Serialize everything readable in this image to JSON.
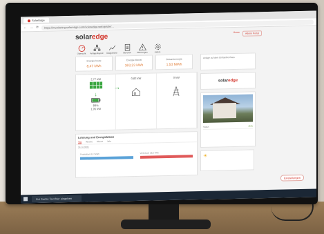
{
  "browser": {
    "tab_title": "SolarEdge",
    "url": "https://monitoring.solaredge.com/solaredge-web/p/site/..."
  },
  "header": {
    "logo_main": "solar",
    "logo_accent": "edge",
    "right_link": "Home",
    "right_button": "Admin Portal"
  },
  "nav": [
    {
      "label": "Übersicht"
    },
    {
      "label": "Anlagenlayout"
    },
    {
      "label": "Diagramme"
    },
    {
      "label": "Berichte"
    },
    {
      "label": "Warnungen"
    },
    {
      "label": "Admin"
    }
  ],
  "kpis": [
    {
      "label": "Energie heute",
      "value": "8,47 kWh"
    },
    {
      "label": "Energie Monat",
      "value": "363,23 kWh"
    },
    {
      "label": "Gesamtenergie",
      "value": "1,53 MWh"
    }
  ],
  "flow": {
    "pv_power": "2,77 kW",
    "home_power": "0,82 kW",
    "grid_power": "0 kW",
    "battery_label": "88%",
    "battery_power": "1,95 kW"
  },
  "side": {
    "site_text": "Anlage auf dem Einfamilienhaus",
    "details": [
      {
        "k": "Status",
        "v": "Aktiv"
      }
    ]
  },
  "production": {
    "title": "Leistung und Energiebilanz",
    "tabs": [
      "Tag",
      "Woche",
      "Monat",
      "Jahr"
    ],
    "date": "25.10.2021",
    "production_label": "Produktion",
    "production_value": "8,47 kWh",
    "consumption_label": "Verbrauch",
    "consumption_value": "18,2 kWh"
  },
  "pill": "Einstellungen",
  "taskbar": {
    "search": "Zur Suche Text hier eingeben"
  },
  "colors": {
    "accent": "#d3342a",
    "kpi": "#e07a33",
    "arrow": "#3aa640"
  }
}
